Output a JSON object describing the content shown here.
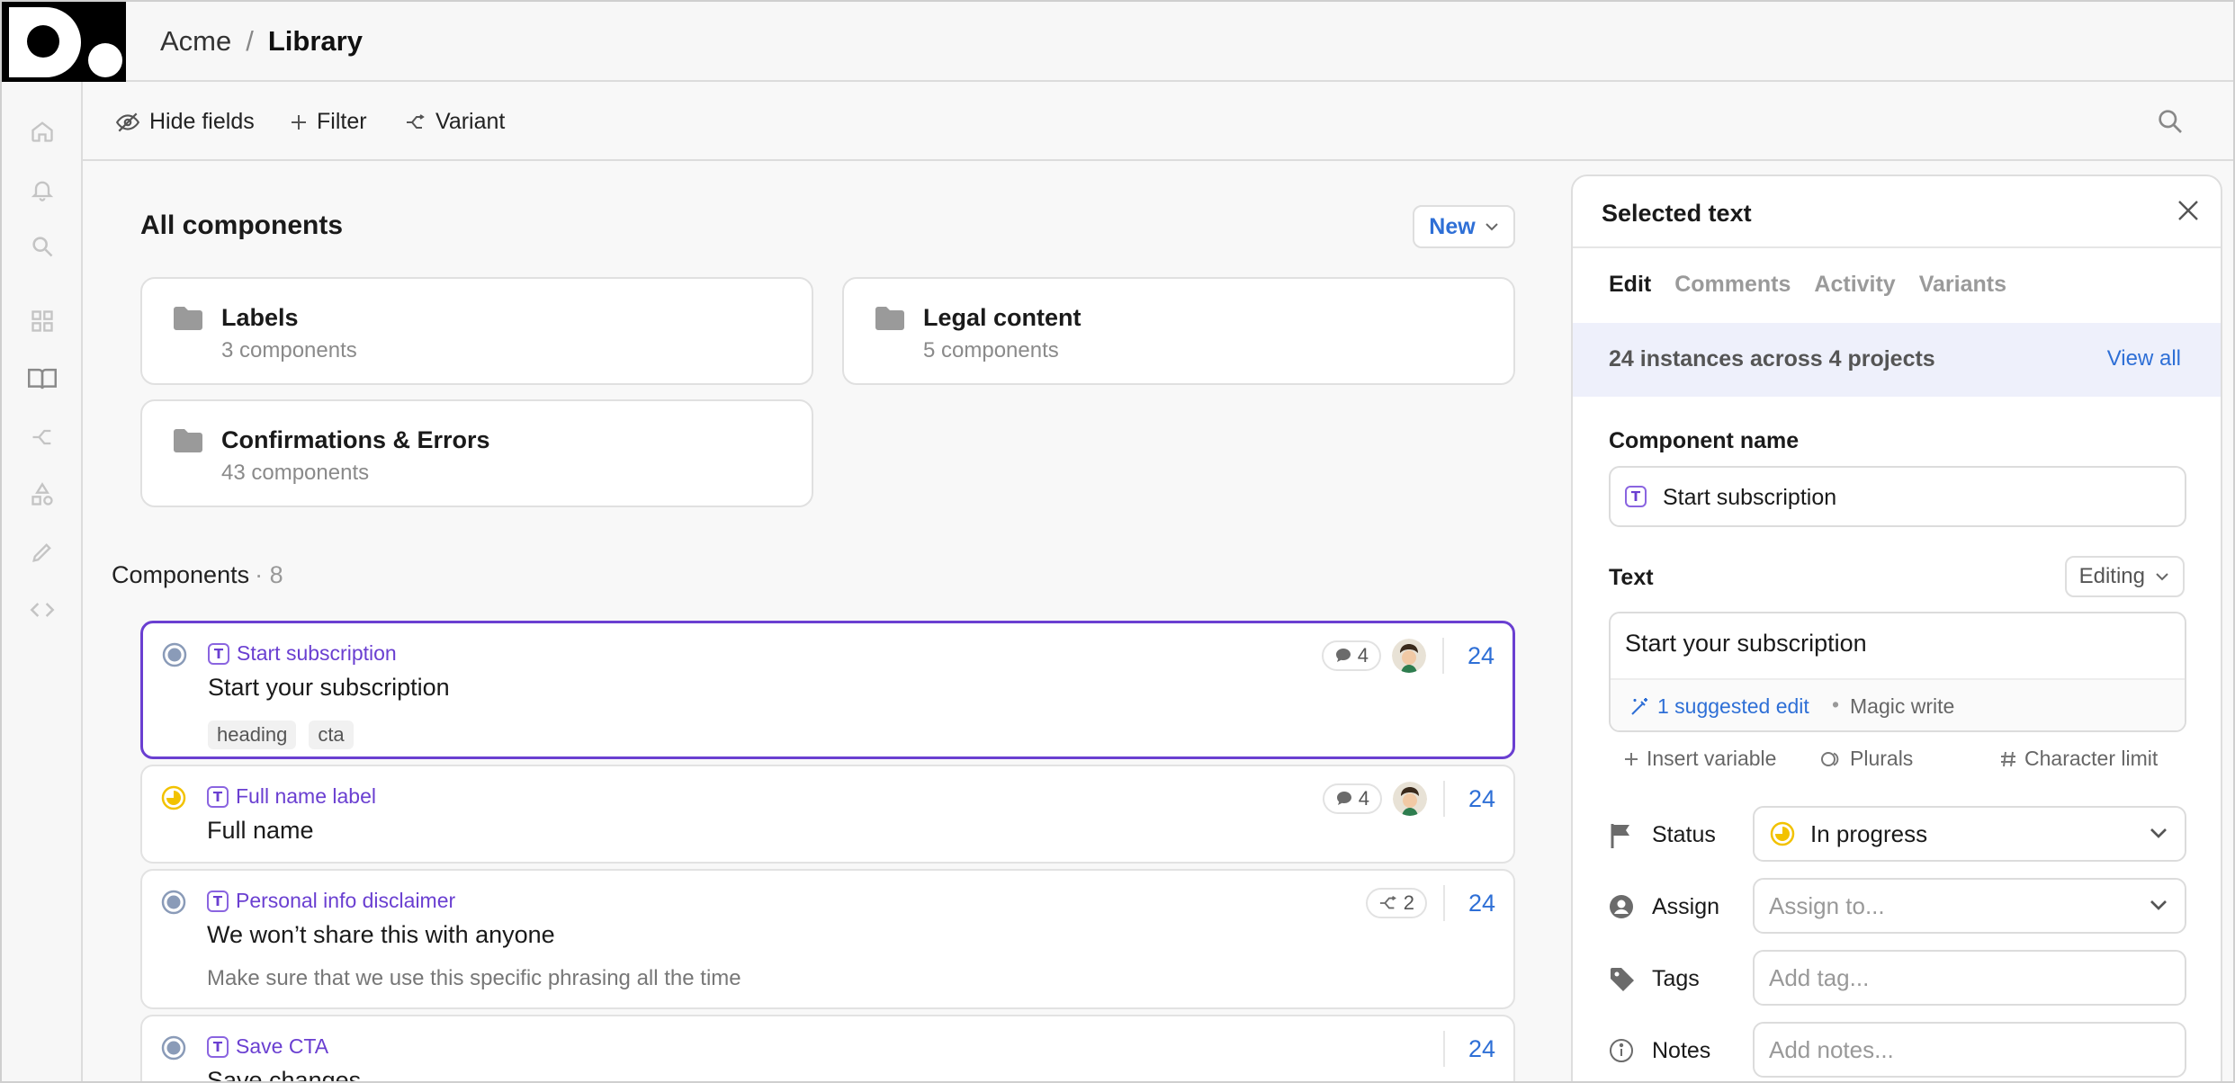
{
  "app": {
    "breadcrumb": {
      "org": "Acme",
      "separator": "/",
      "page": "Library"
    }
  },
  "toolbar": {
    "hide_fields": "Hide fields",
    "filter": "Filter",
    "variant": "Variant"
  },
  "rail": {
    "icons": [
      "home-icon",
      "bell-icon",
      "search-icon",
      "grid-icon",
      "book-icon",
      "variant-icon",
      "shapes-icon",
      "pen-icon",
      "code-icon"
    ]
  },
  "main": {
    "title": "All components",
    "new_button": "New",
    "folders": [
      {
        "name": "Labels",
        "count": "3 components"
      },
      {
        "name": "Legal content",
        "count": "5 components"
      },
      {
        "name": "Confirmations & Errors",
        "count": "43 components"
      }
    ],
    "components_heading": "Components",
    "components_count": "· 8",
    "components": [
      {
        "name": "Start subscription",
        "text": "Start your subscription",
        "tags": [
          "heading",
          "cta"
        ],
        "comments": "4",
        "instances": "24",
        "status": "none"
      },
      {
        "name": "Full name label",
        "text": "Full name",
        "comments": "4",
        "instances": "24",
        "status": "in-progress"
      },
      {
        "name": "Personal info disclaimer",
        "text": "We won’t share this with anyone",
        "note": "Make sure that we use this specific phrasing all the time",
        "variants": "2",
        "instances": "24",
        "status": "none"
      },
      {
        "name": "Save CTA",
        "text": "Save changes",
        "instances": "24",
        "status": "none"
      }
    ]
  },
  "panel": {
    "title": "Selected text",
    "tabs": [
      "Edit",
      "Comments",
      "Activity",
      "Variants"
    ],
    "instances_text": "24 instances across 4 projects",
    "view_all": "View all",
    "component_name_label": "Component name",
    "component_name_value": "Start subscription",
    "text_label": "Text",
    "editing_label": "Editing",
    "text_value": "Start your subscription",
    "suggested_edit": "1 suggested edit",
    "bullet": "•",
    "magic_write": "Magic write",
    "insert_variable": "Insert variable",
    "plurals": "Plurals",
    "character_limit": "Character limit",
    "status_label": "Status",
    "status_value": "In progress",
    "assign_label": "Assign",
    "assign_placeholder": "Assign to...",
    "tags_label": "Tags",
    "tags_placeholder": "Add tag...",
    "notes_label": "Notes",
    "notes_placeholder": "Add notes..."
  },
  "colors": {
    "accent_purple": "#6a3fd1",
    "link_blue": "#2e6fd6",
    "in_progress_yellow": "#f2c200",
    "status_none_gray": "#8a9bb8"
  }
}
